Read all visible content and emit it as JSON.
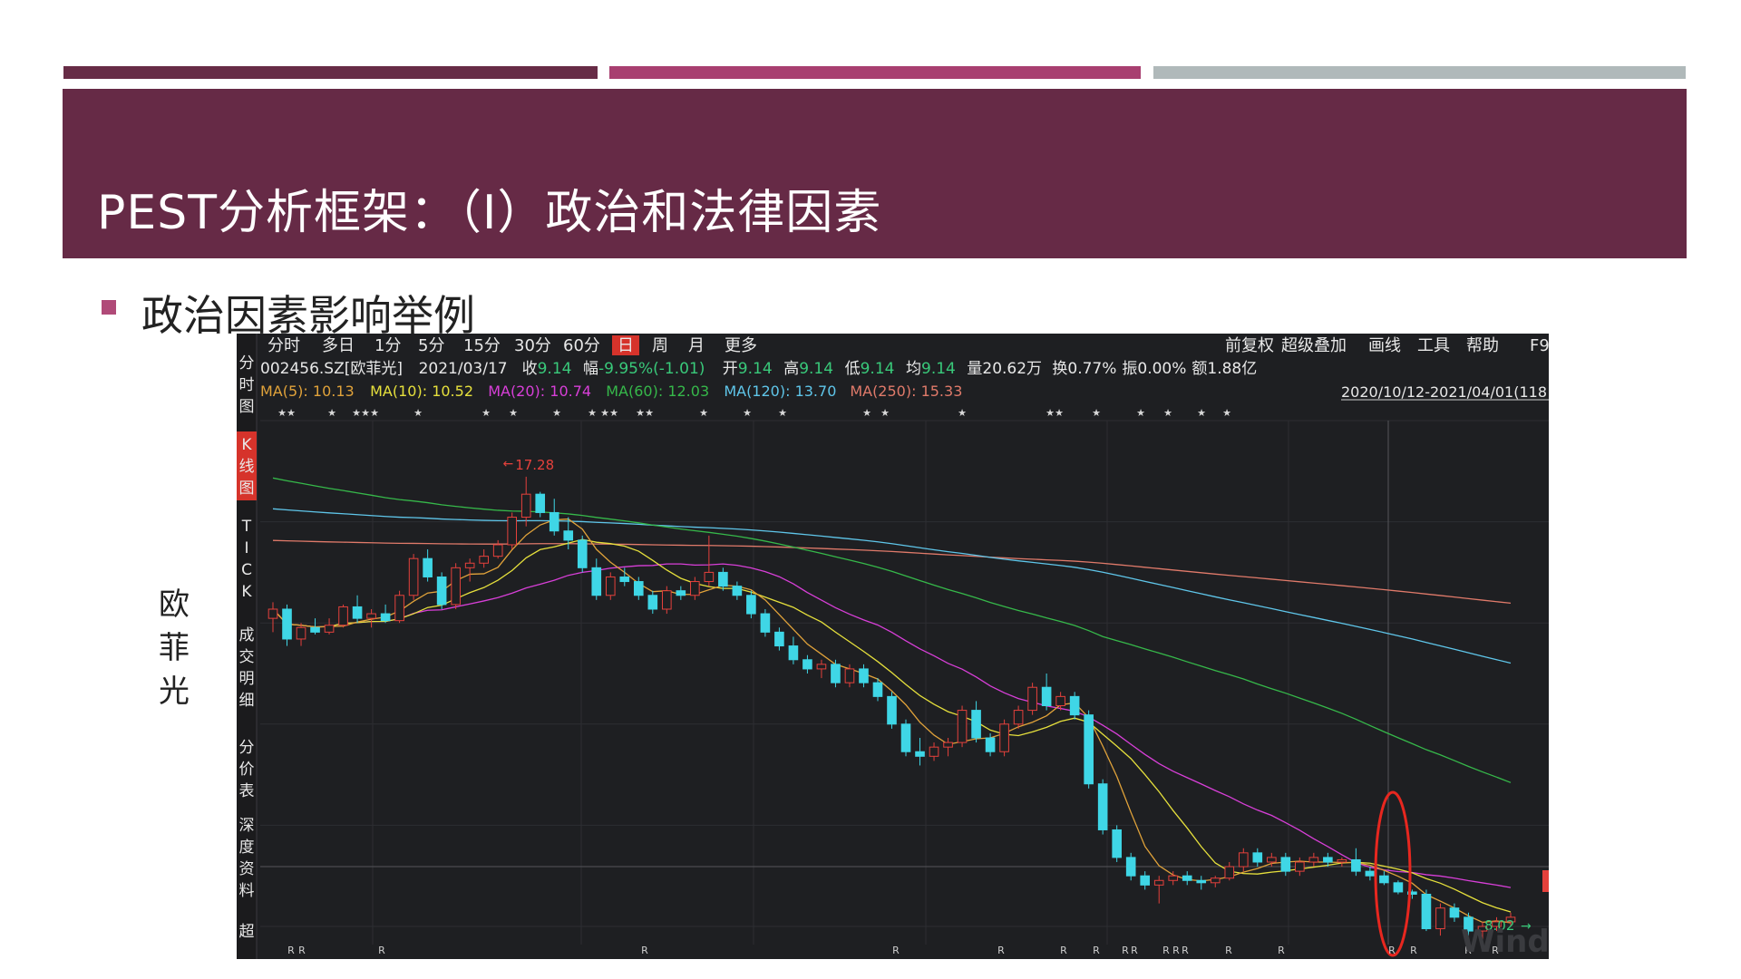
{
  "slide": {
    "title": "PEST分析框架：（I）政治和法律因素",
    "bullet": "政治因素影响举例",
    "side_label": "欧菲光",
    "colors": {
      "band": "#662a46",
      "bar1": "#672c46",
      "bar2": "#a83f70",
      "bar3": "#b0b9ba",
      "bullet": "#b04a78"
    }
  },
  "terminal": {
    "period_tabs": [
      "分时",
      "多日",
      "1分",
      "5分",
      "15分",
      "30分",
      "60分",
      "日",
      "周",
      "月",
      "更多"
    ],
    "active_tab": "日",
    "right_menu": [
      "前复权",
      "超级叠加",
      "画线",
      "工具",
      "帮助",
      "F9"
    ],
    "side_tabs": [
      "分时图",
      "K线图",
      "TICK",
      "成交明细",
      "分价表",
      "深度资料",
      "超"
    ],
    "active_side_tab": "K线图",
    "quote": {
      "code": "002456.SZ[欧菲光]",
      "date": "2021/03/17",
      "close_label": "收",
      "close": "9.14",
      "change_label": "幅",
      "change": "-9.95%(-1.01)",
      "open_label": "开",
      "open": "9.14",
      "high_label": "高",
      "high": "9.14",
      "low_label": "低",
      "low": "9.14",
      "avg_label": "均",
      "avg": "9.14",
      "volume": "量20.62万",
      "turnover": "换0.77%",
      "amplitude": "振0.00%",
      "amount": "额1.88亿"
    },
    "ma_legend": [
      {
        "text": "MA(5): 10.13",
        "color": "#e0a23a"
      },
      {
        "text": "MA(10): 10.52",
        "color": "#e6e03c"
      },
      {
        "text": "MA(20): 10.74",
        "color": "#d83fd8"
      },
      {
        "text": "MA(60): 12.03",
        "color": "#36b84a"
      },
      {
        "text": "MA(120): 13.70",
        "color": "#5fc6ea"
      },
      {
        "text": "MA(250): 15.33",
        "color": "#e07a6a"
      }
    ],
    "range": "2020/10/12-2021/04/01(118",
    "watermark": "Wind",
    "high_marker": "17.28",
    "low_marker": "8.02"
  },
  "chart_data": {
    "type": "candlestick",
    "y_range": [
      7.5,
      18.5
    ],
    "y_unit": "CNY",
    "x_range_label": "2020/10/12-2021/04/01",
    "candles": [
      [
        14.2,
        14.55,
        13.9,
        14.4
      ],
      [
        14.4,
        14.5,
        13.6,
        13.75
      ],
      [
        13.75,
        14.1,
        13.6,
        14.0
      ],
      [
        14.0,
        14.2,
        13.85,
        13.9
      ],
      [
        13.9,
        14.2,
        13.85,
        14.05
      ],
      [
        14.05,
        14.5,
        14.0,
        14.45
      ],
      [
        14.45,
        14.7,
        14.1,
        14.2
      ],
      [
        14.2,
        14.4,
        14.0,
        14.3
      ],
      [
        14.3,
        14.5,
        14.1,
        14.15
      ],
      [
        14.15,
        14.8,
        14.1,
        14.7
      ],
      [
        14.7,
        15.6,
        14.6,
        15.5
      ],
      [
        15.5,
        15.7,
        15.0,
        15.1
      ],
      [
        15.1,
        15.2,
        14.4,
        14.5
      ],
      [
        14.5,
        15.4,
        14.4,
        15.3
      ],
      [
        15.3,
        15.5,
        15.0,
        15.4
      ],
      [
        15.4,
        15.7,
        15.3,
        15.55
      ],
      [
        15.55,
        15.9,
        15.5,
        15.8
      ],
      [
        15.8,
        16.5,
        15.7,
        16.4
      ],
      [
        16.4,
        17.28,
        16.2,
        16.9
      ],
      [
        16.9,
        16.95,
        16.4,
        16.5
      ],
      [
        16.5,
        16.8,
        16.0,
        16.1
      ],
      [
        16.1,
        16.4,
        15.7,
        15.9
      ],
      [
        15.9,
        16.0,
        15.2,
        15.3
      ],
      [
        15.3,
        15.5,
        14.6,
        14.7
      ],
      [
        14.7,
        15.2,
        14.6,
        15.1
      ],
      [
        15.1,
        15.3,
        14.9,
        15.0
      ],
      [
        15.0,
        15.1,
        14.6,
        14.7
      ],
      [
        14.7,
        14.8,
        14.3,
        14.4
      ],
      [
        14.4,
        14.9,
        14.3,
        14.8
      ],
      [
        14.8,
        14.9,
        14.6,
        14.7
      ],
      [
        14.7,
        15.1,
        14.6,
        15.0
      ],
      [
        15.0,
        16.0,
        14.9,
        15.2
      ],
      [
        15.2,
        15.3,
        14.8,
        14.9
      ],
      [
        14.9,
        15.0,
        14.6,
        14.7
      ],
      [
        14.7,
        14.8,
        14.2,
        14.3
      ],
      [
        14.3,
        14.4,
        13.8,
        13.9
      ],
      [
        13.9,
        14.0,
        13.5,
        13.6
      ],
      [
        13.6,
        13.8,
        13.2,
        13.3
      ],
      [
        13.3,
        13.4,
        13.0,
        13.1
      ],
      [
        13.1,
        13.3,
        12.9,
        13.2
      ],
      [
        13.2,
        13.3,
        12.7,
        12.8
      ],
      [
        12.8,
        13.2,
        12.7,
        13.1
      ],
      [
        13.1,
        13.2,
        12.7,
        12.8
      ],
      [
        12.8,
        12.9,
        12.4,
        12.5
      ],
      [
        12.5,
        12.6,
        11.8,
        11.9
      ],
      [
        11.9,
        12.0,
        11.2,
        11.3
      ],
      [
        11.3,
        11.6,
        11.0,
        11.2
      ],
      [
        11.2,
        11.5,
        11.1,
        11.4
      ],
      [
        11.4,
        11.6,
        11.2,
        11.5
      ],
      [
        11.5,
        12.3,
        11.4,
        12.2
      ],
      [
        12.2,
        12.4,
        11.5,
        11.6
      ],
      [
        11.6,
        11.7,
        11.2,
        11.3
      ],
      [
        11.3,
        12.0,
        11.2,
        11.9
      ],
      [
        11.9,
        12.3,
        11.8,
        12.2
      ],
      [
        12.2,
        12.8,
        12.1,
        12.7
      ],
      [
        12.7,
        13.0,
        12.2,
        12.3
      ],
      [
        12.3,
        12.6,
        12.2,
        12.5
      ],
      [
        12.5,
        12.6,
        12.0,
        12.1
      ],
      [
        12.1,
        12.2,
        10.5,
        10.6
      ],
      [
        10.6,
        10.7,
        9.5,
        9.6
      ],
      [
        9.6,
        9.7,
        8.9,
        9.0
      ],
      [
        9.0,
        9.1,
        8.5,
        8.6
      ],
      [
        8.6,
        8.7,
        8.3,
        8.4
      ],
      [
        8.4,
        8.6,
        8.0,
        8.5
      ],
      [
        8.5,
        8.7,
        8.4,
        8.6
      ],
      [
        8.6,
        8.7,
        8.4,
        8.5
      ],
      [
        8.5,
        8.6,
        8.3,
        8.45
      ],
      [
        8.45,
        8.6,
        8.35,
        8.55
      ],
      [
        8.55,
        8.9,
        8.5,
        8.8
      ],
      [
        8.8,
        9.2,
        8.7,
        9.1
      ],
      [
        9.1,
        9.2,
        8.8,
        8.9
      ],
      [
        8.9,
        9.1,
        8.8,
        9.0
      ],
      [
        9.0,
        9.1,
        8.6,
        8.7
      ],
      [
        8.7,
        9.0,
        8.6,
        8.9
      ],
      [
        8.9,
        9.1,
        8.8,
        9.0
      ],
      [
        9.0,
        9.1,
        8.8,
        8.9
      ],
      [
        8.9,
        9.0,
        8.8,
        8.95
      ],
      [
        8.95,
        9.2,
        8.6,
        8.7
      ],
      [
        8.7,
        8.8,
        8.5,
        8.6
      ],
      [
        8.6,
        8.7,
        8.4,
        8.45
      ],
      [
        8.45,
        8.5,
        8.2,
        8.25
      ],
      [
        8.25,
        8.3,
        8.1,
        8.2
      ],
      [
        8.2,
        8.3,
        7.4,
        7.45
      ],
      [
        7.45,
        8.0,
        7.3,
        7.9
      ],
      [
        7.9,
        8.0,
        7.6,
        7.7
      ],
      [
        7.7,
        7.8,
        7.3,
        7.4
      ],
      [
        7.4,
        7.6,
        7.2,
        7.5
      ],
      [
        7.5,
        7.7,
        7.4,
        7.6
      ],
      [
        7.6,
        7.8,
        7.5,
        7.7
      ]
    ]
  }
}
